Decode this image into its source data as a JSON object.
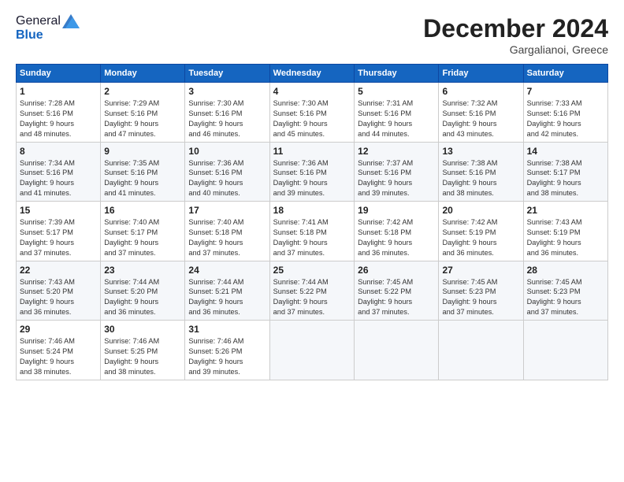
{
  "header": {
    "logo_general": "General",
    "logo_blue": "Blue",
    "month_title": "December 2024",
    "location": "Gargalianoi, Greece"
  },
  "weekdays": [
    "Sunday",
    "Monday",
    "Tuesday",
    "Wednesday",
    "Thursday",
    "Friday",
    "Saturday"
  ],
  "weeks": [
    [
      {
        "day": "1",
        "info": "Sunrise: 7:28 AM\nSunset: 5:16 PM\nDaylight: 9 hours\nand 48 minutes."
      },
      {
        "day": "2",
        "info": "Sunrise: 7:29 AM\nSunset: 5:16 PM\nDaylight: 9 hours\nand 47 minutes."
      },
      {
        "day": "3",
        "info": "Sunrise: 7:30 AM\nSunset: 5:16 PM\nDaylight: 9 hours\nand 46 minutes."
      },
      {
        "day": "4",
        "info": "Sunrise: 7:30 AM\nSunset: 5:16 PM\nDaylight: 9 hours\nand 45 minutes."
      },
      {
        "day": "5",
        "info": "Sunrise: 7:31 AM\nSunset: 5:16 PM\nDaylight: 9 hours\nand 44 minutes."
      },
      {
        "day": "6",
        "info": "Sunrise: 7:32 AM\nSunset: 5:16 PM\nDaylight: 9 hours\nand 43 minutes."
      },
      {
        "day": "7",
        "info": "Sunrise: 7:33 AM\nSunset: 5:16 PM\nDaylight: 9 hours\nand 42 minutes."
      }
    ],
    [
      {
        "day": "8",
        "info": "Sunrise: 7:34 AM\nSunset: 5:16 PM\nDaylight: 9 hours\nand 41 minutes."
      },
      {
        "day": "9",
        "info": "Sunrise: 7:35 AM\nSunset: 5:16 PM\nDaylight: 9 hours\nand 41 minutes."
      },
      {
        "day": "10",
        "info": "Sunrise: 7:36 AM\nSunset: 5:16 PM\nDaylight: 9 hours\nand 40 minutes."
      },
      {
        "day": "11",
        "info": "Sunrise: 7:36 AM\nSunset: 5:16 PM\nDaylight: 9 hours\nand 39 minutes."
      },
      {
        "day": "12",
        "info": "Sunrise: 7:37 AM\nSunset: 5:16 PM\nDaylight: 9 hours\nand 39 minutes."
      },
      {
        "day": "13",
        "info": "Sunrise: 7:38 AM\nSunset: 5:16 PM\nDaylight: 9 hours\nand 38 minutes."
      },
      {
        "day": "14",
        "info": "Sunrise: 7:38 AM\nSunset: 5:17 PM\nDaylight: 9 hours\nand 38 minutes."
      }
    ],
    [
      {
        "day": "15",
        "info": "Sunrise: 7:39 AM\nSunset: 5:17 PM\nDaylight: 9 hours\nand 37 minutes."
      },
      {
        "day": "16",
        "info": "Sunrise: 7:40 AM\nSunset: 5:17 PM\nDaylight: 9 hours\nand 37 minutes."
      },
      {
        "day": "17",
        "info": "Sunrise: 7:40 AM\nSunset: 5:18 PM\nDaylight: 9 hours\nand 37 minutes."
      },
      {
        "day": "18",
        "info": "Sunrise: 7:41 AM\nSunset: 5:18 PM\nDaylight: 9 hours\nand 37 minutes."
      },
      {
        "day": "19",
        "info": "Sunrise: 7:42 AM\nSunset: 5:18 PM\nDaylight: 9 hours\nand 36 minutes."
      },
      {
        "day": "20",
        "info": "Sunrise: 7:42 AM\nSunset: 5:19 PM\nDaylight: 9 hours\nand 36 minutes."
      },
      {
        "day": "21",
        "info": "Sunrise: 7:43 AM\nSunset: 5:19 PM\nDaylight: 9 hours\nand 36 minutes."
      }
    ],
    [
      {
        "day": "22",
        "info": "Sunrise: 7:43 AM\nSunset: 5:20 PM\nDaylight: 9 hours\nand 36 minutes."
      },
      {
        "day": "23",
        "info": "Sunrise: 7:44 AM\nSunset: 5:20 PM\nDaylight: 9 hours\nand 36 minutes."
      },
      {
        "day": "24",
        "info": "Sunrise: 7:44 AM\nSunset: 5:21 PM\nDaylight: 9 hours\nand 36 minutes."
      },
      {
        "day": "25",
        "info": "Sunrise: 7:44 AM\nSunset: 5:22 PM\nDaylight: 9 hours\nand 37 minutes."
      },
      {
        "day": "26",
        "info": "Sunrise: 7:45 AM\nSunset: 5:22 PM\nDaylight: 9 hours\nand 37 minutes."
      },
      {
        "day": "27",
        "info": "Sunrise: 7:45 AM\nSunset: 5:23 PM\nDaylight: 9 hours\nand 37 minutes."
      },
      {
        "day": "28",
        "info": "Sunrise: 7:45 AM\nSunset: 5:23 PM\nDaylight: 9 hours\nand 37 minutes."
      }
    ],
    [
      {
        "day": "29",
        "info": "Sunrise: 7:46 AM\nSunset: 5:24 PM\nDaylight: 9 hours\nand 38 minutes."
      },
      {
        "day": "30",
        "info": "Sunrise: 7:46 AM\nSunset: 5:25 PM\nDaylight: 9 hours\nand 38 minutes."
      },
      {
        "day": "31",
        "info": "Sunrise: 7:46 AM\nSunset: 5:26 PM\nDaylight: 9 hours\nand 39 minutes."
      },
      null,
      null,
      null,
      null
    ]
  ]
}
